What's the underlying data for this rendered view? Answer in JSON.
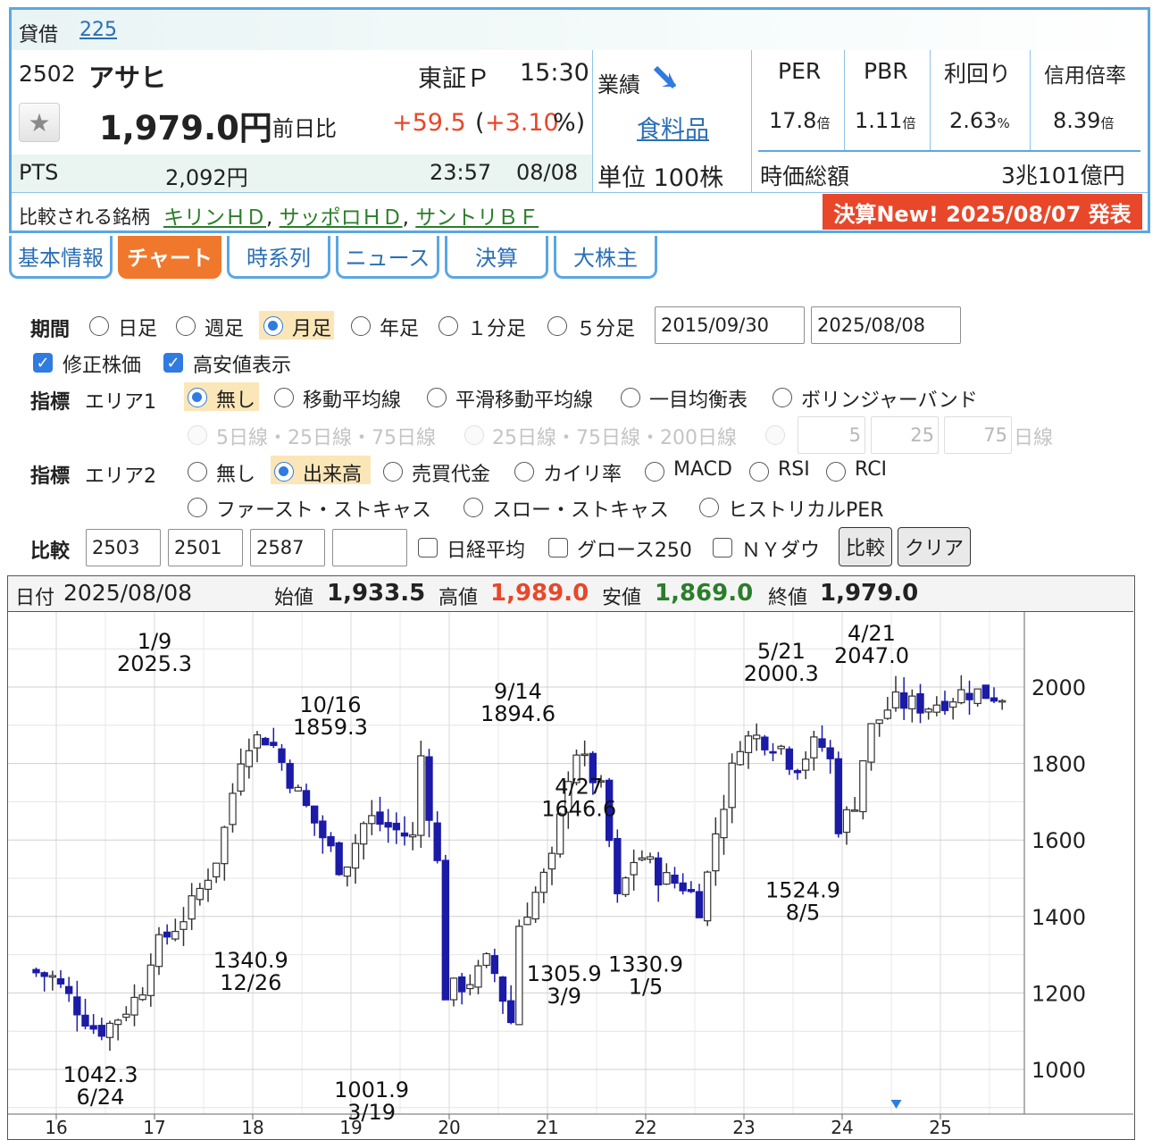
{
  "header": {
    "tag": "貸借",
    "index_link": "225",
    "code": "2502",
    "name": "アサヒ",
    "market": "東証Ｐ",
    "time": "15:30",
    "price": "1,979.0円",
    "change_label": "前日比",
    "change": "+59.5",
    "change_pct_open": "(",
    "change_pct": "+3.10",
    "change_pct_close": "%)",
    "pts_label": "PTS",
    "pts_price": "2,092円",
    "pts_time": "23:57",
    "pts_date": "08/08",
    "gyoseki": "業績",
    "sector": "食料品",
    "unit": "単位 100株",
    "metrics": [
      {
        "label": "PER",
        "value": "17.8",
        "unit": "倍"
      },
      {
        "label": "PBR",
        "value": "1.11",
        "unit": "倍"
      },
      {
        "label": "利回り",
        "value": "2.63",
        "unit": "%"
      },
      {
        "label": "信用倍率",
        "value": "8.39",
        "unit": "倍"
      }
    ],
    "mcap_label": "時価総額",
    "mcap_value": "3兆101億円",
    "compare_label": "比較される銘柄",
    "compare_links": [
      "キリンＨＤ",
      "サッポロＨＤ",
      "サントリＢＦ"
    ],
    "earnings_badge": "決算New! 2025/08/07 発表"
  },
  "tabs": [
    "基本情報",
    "チャート",
    "時系列",
    "ニュース",
    "決算",
    "大株主"
  ],
  "form": {
    "period_label": "期間",
    "period_options": [
      "日足",
      "週足",
      "月足",
      "年足",
      "１分足",
      "５分足"
    ],
    "period_selected": 2,
    "date_from": "2015/09/30",
    "date_to": "2025/08/08",
    "check_adjusted": "修正株価",
    "check_highlow": "高安値表示",
    "ind_label": "指標",
    "area1_label": "エリア1",
    "area1_options": [
      "無し",
      "移動平均線",
      "平滑移動平均線",
      "一目均衡表",
      "ボリンジャーバンド"
    ],
    "ma_options": [
      "5日線・25日線・75日線",
      "25日線・75日線・200日線"
    ],
    "ma_inputs": [
      "5",
      "25",
      "75"
    ],
    "ma_unit": "日線",
    "area2_label": "エリア2",
    "area2_options": [
      "無し",
      "出来高",
      "売買代金",
      "カイリ率",
      "MACD",
      "RSI",
      "RCI",
      "ファースト・ストキャス",
      "スロー・ストキャス",
      "ヒストリカルPER"
    ],
    "compare_label": "比較",
    "compare_codes": [
      "2503",
      "2501",
      "2587",
      ""
    ],
    "compare_checks": [
      "日経平均",
      "グロース250",
      "ＮＹダウ"
    ],
    "compare_button": "比較",
    "clear_button": "クリア"
  },
  "ohlc": {
    "date_label": "日付",
    "date": "2025/08/08",
    "open_label": "始値",
    "open": "1,933.5",
    "high_label": "高値",
    "high": "1,989.0",
    "low_label": "安値",
    "low": "1,869.0",
    "close_label": "終値",
    "close": "1,979.0"
  },
  "colors": {
    "border_blue": "#5ba7e3",
    "tab_active": "#f0782d",
    "badge_red": "#e8472a",
    "up_red": "#e8472a",
    "down_green": "#2b7d2b",
    "candle_down": "#1b1ba8"
  },
  "icons": [
    "star-icon",
    "arrow-down-right-icon",
    "triangle-marker-icon"
  ],
  "chart_data": {
    "type": "candlestick",
    "ylim": [
      900,
      2150
    ],
    "y_ticks": [
      1000,
      1200,
      1400,
      1600,
      1800,
      2000
    ],
    "x_ticks": [
      "16",
      "17",
      "18",
      "19",
      "20",
      "21",
      "22",
      "23",
      "24",
      "25"
    ],
    "x_range": [
      2015.75,
      2025.6
    ],
    "annotations": [
      {
        "x": 2016.45,
        "price": "1042.3",
        "date": "6/24",
        "pos": "below"
      },
      {
        "x": 2017.0,
        "price": "2025.3",
        "date": "1/9",
        "pos": "above"
      },
      {
        "x": 2017.98,
        "price": "1340.9",
        "date": "12/26",
        "pos": "below"
      },
      {
        "x": 2018.79,
        "price": "1859.3",
        "date": "10/16",
        "pos": "above"
      },
      {
        "x": 2019.21,
        "price": "1001.9",
        "date": "3/19",
        "pos": "below"
      },
      {
        "x": 2020.7,
        "price": "1894.6",
        "date": "9/14",
        "pos": "above"
      },
      {
        "x": 2021.17,
        "price": "1305.9",
        "date": "3/9",
        "pos": "below"
      },
      {
        "x": 2021.32,
        "price": "1646.6",
        "date": "4/27",
        "pos": "above"
      },
      {
        "x": 2022.0,
        "price": "1330.9",
        "date": "1/5",
        "pos": "below"
      },
      {
        "x": 2023.38,
        "price": "2000.3",
        "date": "5/21",
        "pos": "above"
      },
      {
        "x": 2023.6,
        "price": "1524.9",
        "date": "8/5",
        "pos": "below"
      },
      {
        "x": 2024.3,
        "price": "2047.0",
        "date": "4/21",
        "pos": "above"
      }
    ],
    "anchors": [
      [
        2015.75,
        1260
      ],
      [
        2016.0,
        1240
      ],
      [
        2016.45,
        1100
      ],
      [
        2016.6,
        1120
      ],
      [
        2016.9,
        1200
      ],
      [
        2017.0,
        1300
      ],
      [
        2017.4,
        1420
      ],
      [
        2017.7,
        1570
      ],
      [
        2017.95,
        1860
      ],
      [
        2018.2,
        1870
      ],
      [
        2018.5,
        1720
      ],
      [
        2018.95,
        1520
      ],
      [
        2019.2,
        1660
      ],
      [
        2019.7,
        1600
      ],
      [
        2019.75,
        1820
      ],
      [
        2019.95,
        1480
      ],
      [
        2020.0,
        1200
      ],
      [
        2020.3,
        1240
      ],
      [
        2020.45,
        1290
      ],
      [
        2020.7,
        1100
      ],
      [
        2020.75,
        1380
      ],
      [
        2021.1,
        1550
      ],
      [
        2021.3,
        1850
      ],
      [
        2021.6,
        1720
      ],
      [
        2021.75,
        1440
      ],
      [
        2021.95,
        1570
      ],
      [
        2022.2,
        1500
      ],
      [
        2022.45,
        1480
      ],
      [
        2022.6,
        1420
      ],
      [
        2022.75,
        1620
      ],
      [
        2023.0,
        1860
      ],
      [
        2023.2,
        1870
      ],
      [
        2023.4,
        1850
      ],
      [
        2023.55,
        1790
      ],
      [
        2023.8,
        1860
      ],
      [
        2023.95,
        1790
      ],
      [
        2024.0,
        1640
      ],
      [
        2024.15,
        1680
      ],
      [
        2024.3,
        1880
      ],
      [
        2024.55,
        1960
      ],
      [
        2024.9,
        1950
      ],
      [
        2025.3,
        1990
      ],
      [
        2025.6,
        1979
      ]
    ]
  }
}
